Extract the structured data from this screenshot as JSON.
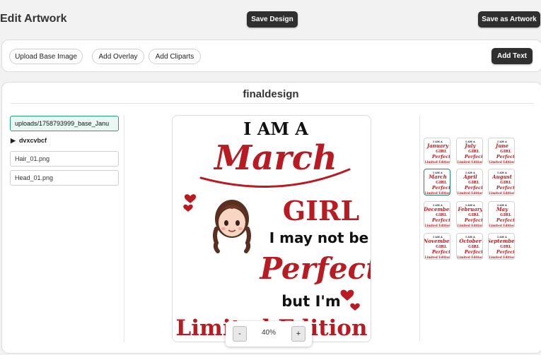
{
  "header": {
    "title": "Edit Artwork",
    "save_design": "Save Design",
    "save_as_artwork": "Save as Artwork"
  },
  "toolbar": {
    "upload_base_image": "Upload Base Image",
    "add_overlay": "Add Overlay",
    "add_cliparts": "Add Cliparts",
    "add_text": "Add Text"
  },
  "design": {
    "title": "finaldesign",
    "layers": {
      "base": "uploads/1758793999_base_Janu",
      "group": "dvxcvbcf",
      "hair": "Hair_01.png",
      "head": "Head_01.png"
    }
  },
  "artwork": {
    "line1": "I AM A",
    "month": "March",
    "line3": "GIRL",
    "line4": "I may not be",
    "line5": "Perfect",
    "line6": "but I'm",
    "line7": "Limited Edition",
    "accent_color": "#b81c22"
  },
  "zoom": {
    "minus": "-",
    "value": "40%",
    "plus": "+"
  },
  "thumbnails": [
    {
      "month": "January",
      "selected": false
    },
    {
      "month": "July",
      "selected": false
    },
    {
      "month": "June",
      "selected": false
    },
    {
      "month": "March",
      "selected": true
    },
    {
      "month": "April",
      "selected": false
    },
    {
      "month": "August",
      "selected": false
    },
    {
      "month": "December",
      "selected": false
    },
    {
      "month": "February",
      "selected": false
    },
    {
      "month": "May",
      "selected": false
    },
    {
      "month": "November",
      "selected": false
    },
    {
      "month": "October",
      "selected": false
    },
    {
      "month": "September",
      "selected": false
    }
  ],
  "thumb_text": {
    "top": "I AM A",
    "girl": "GIRL",
    "perfect": "Perfect",
    "edition": "Limited Edition"
  }
}
